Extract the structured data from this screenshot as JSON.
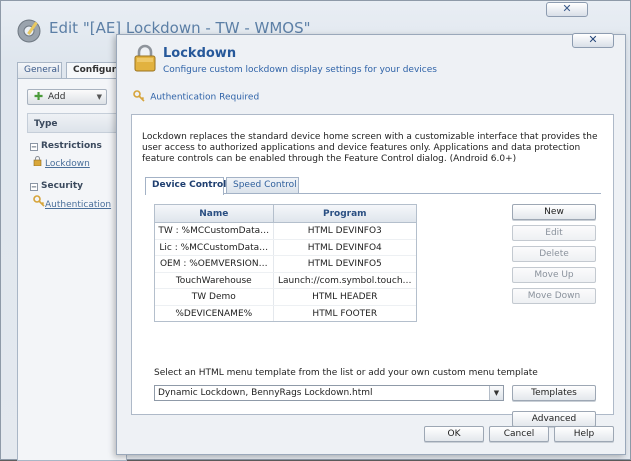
{
  "background": {
    "title": "Edit \"[AE] Lockdown - TW - WMOS\"",
    "close": "✕",
    "tabs": [
      "General",
      "Configura"
    ],
    "add_label": "Add",
    "column_header": "Type",
    "groups": [
      {
        "label": "Restrictions",
        "item": "Lockdown",
        "icon": "lock-icon"
      },
      {
        "label": "Security",
        "item": "Authentication",
        "icon": "key-icon"
      }
    ]
  },
  "dialog": {
    "close": "✕",
    "title": "Lockdown",
    "subtitle": "Configure custom lockdown display settings for your devices",
    "auth_label": "Authentication Required",
    "description": "Lockdown replaces the standard device home screen with a customizable interface that provides the user access to authorized applications and device features only. Applications and data protection feature controls can be enabled through the Feature Control dialog. (Android 6.0+)",
    "tabs": {
      "device_control": "Device Control",
      "speed_control": "Speed Control"
    },
    "table": {
      "columns": [
        "Name",
        "Program"
      ],
      "rows": [
        [
          "TW : %MCCustomData…",
          "HTML DEVINFO3"
        ],
        [
          "Lic : %MCCustomData…",
          "HTML DEVINFO4"
        ],
        [
          "OEM : %OEMVERSION…",
          "HTML DEVINFO5"
        ],
        [
          "TouchWarehouse",
          "Launch://com.symbol.touch…"
        ],
        [
          "TW Demo",
          "HTML HEADER"
        ],
        [
          "%DEVICENAME%",
          "HTML FOOTER"
        ]
      ]
    },
    "side_buttons": {
      "new": "New",
      "edit": "Edit",
      "delete": "Delete",
      "move_up": "Move Up",
      "move_down": "Move Down"
    },
    "template_label": "Select an HTML menu template from the list or add your own custom menu template",
    "template_value": "Dynamic Lockdown, BennyRags Lockdown.html",
    "templates_button": "Templates",
    "advanced_button": "Advanced",
    "footer": {
      "ok": "OK",
      "cancel": "Cancel",
      "help": "Help"
    }
  }
}
